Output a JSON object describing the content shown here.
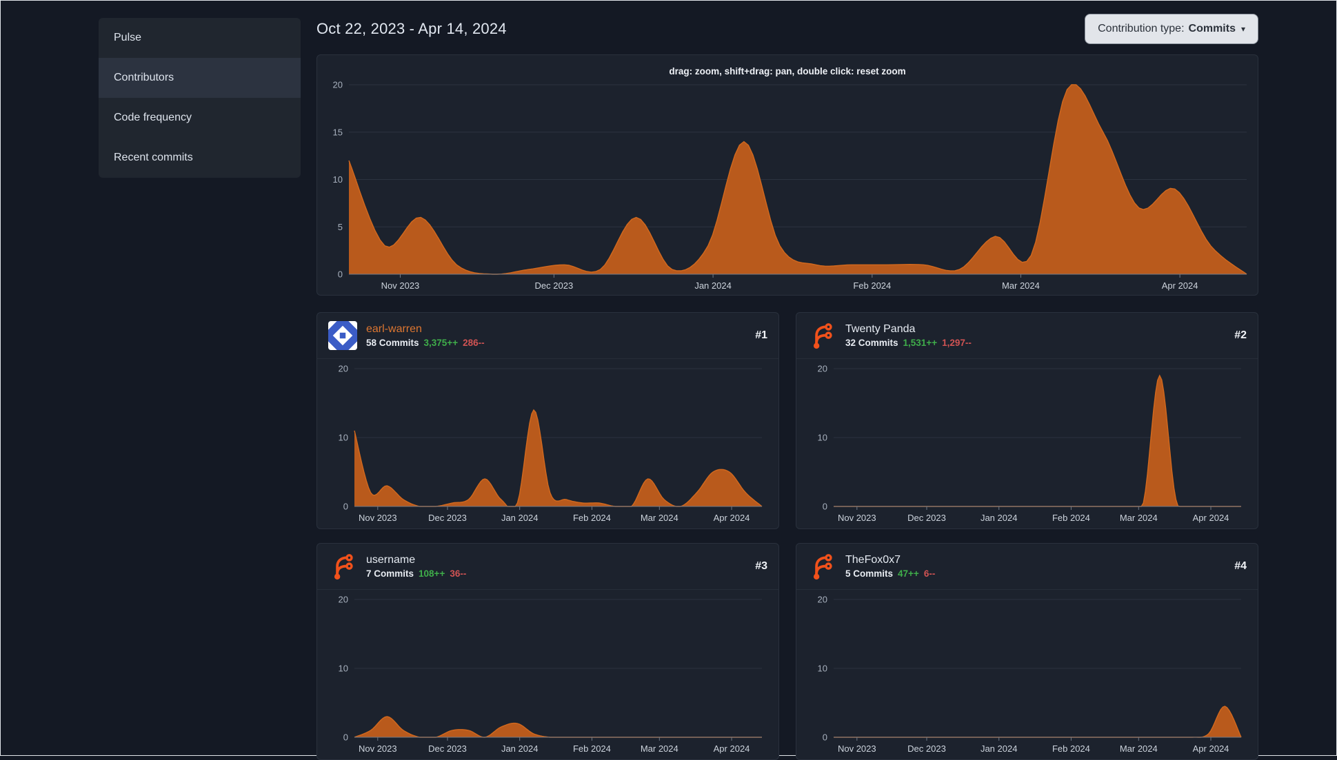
{
  "colors": {
    "accent": "#b95a1c",
    "accent_line": "#d2691e",
    "grid": "#2c3340",
    "axis_line": "#717a87",
    "axis_text": "#a8b1be",
    "x_text": "#ccd3dc",
    "additions": "#3fae4a",
    "deletions": "#d05353"
  },
  "timeline": {
    "max_week": 25,
    "months": [
      {
        "label": "Nov 2023",
        "week": 1.43
      },
      {
        "label": "Dec 2023",
        "week": 5.71
      },
      {
        "label": "Jan 2024",
        "week": 10.14
      },
      {
        "label": "Feb 2024",
        "week": 14.57
      },
      {
        "label": "Mar 2024",
        "week": 18.71
      },
      {
        "label": "Apr 2024",
        "week": 23.14
      }
    ]
  },
  "sidebar": {
    "items": [
      {
        "label": "Pulse",
        "active": false
      },
      {
        "label": "Contributors",
        "active": true
      },
      {
        "label": "Code frequency",
        "active": false
      },
      {
        "label": "Recent commits",
        "active": false
      }
    ]
  },
  "header": {
    "date_range": "Oct 22, 2023 - Apr 14, 2024",
    "contribution_type_label": "Contribution type:",
    "contribution_type_value": "Commits",
    "caret": "▾"
  },
  "main_chart": {
    "hint": "drag: zoom, shift+drag: pan, double click: reset zoom",
    "chart": {
      "y_max": 20,
      "y_ticks": [
        0,
        5,
        10,
        15,
        20
      ],
      "values": [
        12,
        3,
        6,
        1,
        0,
        0.5,
        1,
        0.5,
        6,
        0.5,
        3,
        14,
        3,
        1,
        1,
        1,
        1,
        0.5,
        4,
        2,
        19.5,
        15,
        7,
        9,
        3,
        0
      ]
    }
  },
  "contributors": [
    {
      "rank": "#1",
      "name": "earl-warren",
      "name_color": "#dd7631",
      "commits": "58 Commits",
      "additions": "3,375++",
      "deletions": "286--",
      "chart": {
        "y_max": 20,
        "y_ticks": [
          0,
          10,
          20
        ],
        "values": [
          11,
          2,
          3,
          1,
          0,
          0,
          0.5,
          1,
          4,
          1,
          0.5,
          14,
          2,
          1,
          0.5,
          0.5,
          0,
          0,
          4,
          1,
          0,
          2,
          5,
          5,
          2,
          0
        ]
      }
    },
    {
      "rank": "#2",
      "name": "Twenty Panda",
      "name_color": "#e6ebf2",
      "commits": "32 Commits",
      "additions": "1,531++",
      "deletions": "1,297--",
      "chart": {
        "y_max": 20,
        "y_ticks": [
          0,
          10,
          20
        ],
        "values": [
          0,
          0,
          0,
          0,
          0,
          0,
          0,
          0,
          0,
          0,
          0,
          0,
          0,
          0,
          0,
          0,
          0,
          0,
          0,
          0.5,
          19,
          1,
          0,
          0,
          0,
          0
        ]
      }
    },
    {
      "rank": "#3",
      "name": "username",
      "name_color": "#e6ebf2",
      "commits": "7 Commits",
      "additions": "108++",
      "deletions": "36--",
      "chart": {
        "y_max": 20,
        "y_ticks": [
          0,
          10,
          20
        ],
        "values": [
          0,
          1,
          3,
          1,
          0,
          0,
          1,
          1,
          0,
          1.5,
          2,
          0.5,
          0,
          0,
          0,
          0,
          0,
          0,
          0,
          0,
          0,
          0,
          0,
          0,
          0,
          0
        ]
      }
    },
    {
      "rank": "#4",
      "name": "TheFox0x7",
      "name_color": "#e6ebf2",
      "commits": "5 Commits",
      "additions": "47++",
      "deletions": "6--",
      "chart": {
        "y_max": 20,
        "y_ticks": [
          0,
          10,
          20
        ],
        "values": [
          0,
          0,
          0,
          0,
          0,
          0,
          0,
          0,
          0,
          0,
          0,
          0,
          0,
          0,
          0,
          0,
          0,
          0,
          0,
          0,
          0,
          0,
          0,
          0.5,
          4.5,
          0
        ]
      }
    }
  ]
}
